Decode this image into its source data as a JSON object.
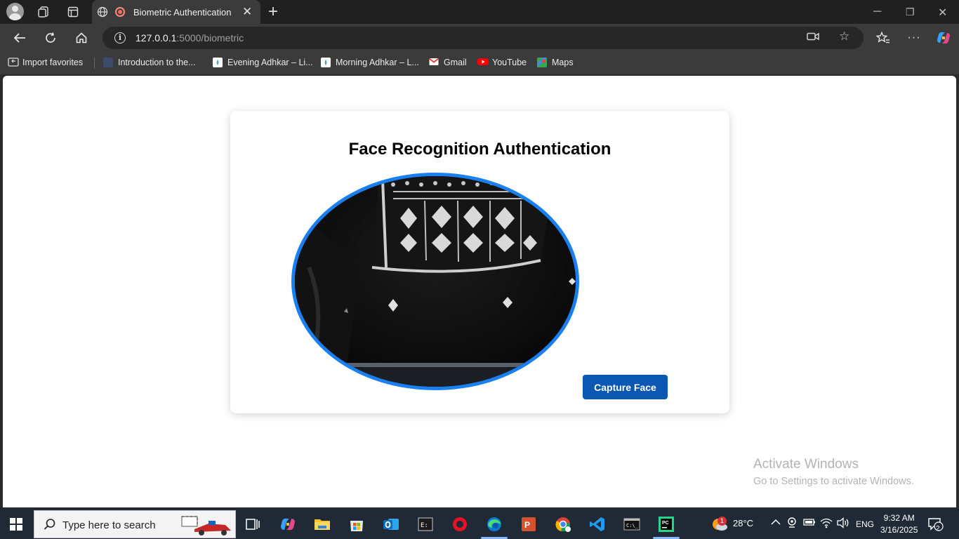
{
  "browser": {
    "tab": {
      "title": "Biometric Authentication"
    },
    "url": {
      "host": "127.0.0.1",
      "rest": ":5000/biometric"
    }
  },
  "favorites": [
    {
      "label": "Import favorites",
      "icon": "import-icon"
    },
    {
      "label": "Introduction to the...",
      "icon": "page-icon"
    },
    {
      "label": "Evening Adhkar – Li...",
      "icon": "page-icon"
    },
    {
      "label": "Morning Adhkar – L...",
      "icon": "page-icon"
    },
    {
      "label": "Gmail",
      "icon": "gmail-icon"
    },
    {
      "label": "YouTube",
      "icon": "youtube-icon"
    },
    {
      "label": "Maps",
      "icon": "maps-icon"
    }
  ],
  "page": {
    "title": "Face Recognition Authentication",
    "capture_button": "Capture Face"
  },
  "watermark": {
    "line1": "Activate Windows",
    "line2": "Go to Settings to activate Windows."
  },
  "taskbar": {
    "search_placeholder": "Type here to search",
    "weather": "28°C",
    "language": "ENG",
    "time": "9:32 AM",
    "date": "3/16/2025",
    "notification_count": "2",
    "weather_badge": "1"
  },
  "colors": {
    "accent_blue": "#1a7ff0",
    "button_blue": "#0a58b4"
  }
}
